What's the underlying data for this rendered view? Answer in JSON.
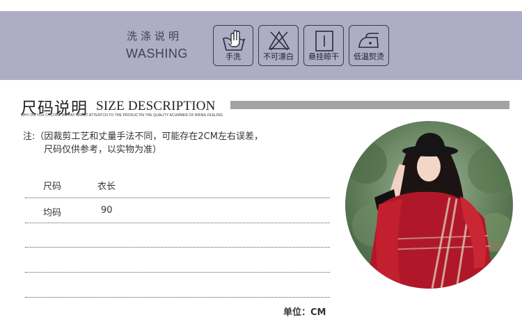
{
  "washing": {
    "title_cn": "洗涤说明",
    "title_en": "WASHING",
    "icons": [
      {
        "name": "hand-wash-icon",
        "label": "手洗"
      },
      {
        "name": "no-bleach-icon",
        "label": "不可漂白"
      },
      {
        "name": "hang-dry-icon",
        "label": "悬挂晾干"
      },
      {
        "name": "low-iron-icon",
        "label": "低温熨烫"
      }
    ]
  },
  "size": {
    "title_cn": "尺码说明",
    "title_en": "SIZE DESCRIPTION",
    "subtitle": "WHY DO YOU CHCOBE WE PAY GREAT ATTENTCN TO THE PRODUCTIN THE QUALITY ACUMMER OF BRING FEELING",
    "note_line1": "注:（因裁剪工艺和丈量手法不同，可能存在2CM左右误差，",
    "note_line2": "尺码仅供参考，以实物为准）",
    "table": {
      "headers": [
        "尺码",
        "衣长"
      ],
      "rows": [
        [
          "均码",
          "90"
        ]
      ]
    },
    "unit": "单位：CM"
  },
  "colors": {
    "banner": "#adadc6",
    "accent_bar": "#a3a3a3",
    "garment_red": "#b0182a"
  }
}
